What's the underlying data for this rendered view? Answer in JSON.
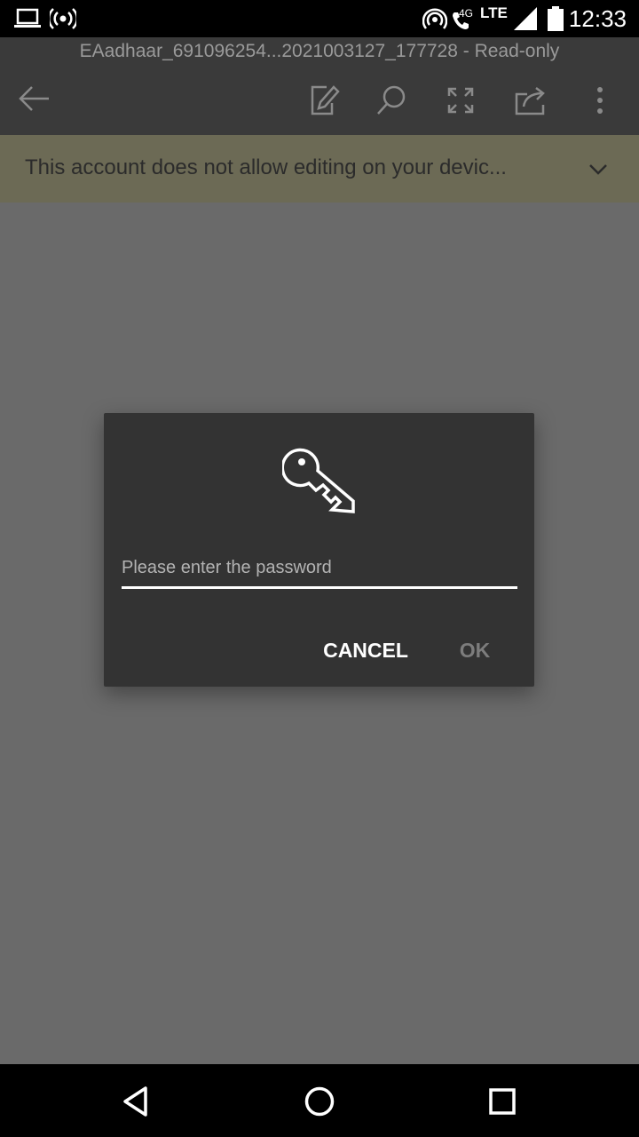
{
  "status_bar": {
    "time": "12:33",
    "network_4g": "4G",
    "network_lte": "LTE",
    "icons": [
      "laptop-icon",
      "hotspot-icon",
      "wifi-calling-icon",
      "signal-icon",
      "battery-icon"
    ]
  },
  "title_bar": {
    "document_title": "EAadhaar_691096254...2021003127_177728 - Read-only",
    "actions": [
      "back-arrow-icon",
      "edit-icon",
      "search-icon",
      "fullscreen-icon",
      "share-icon",
      "more-icon"
    ]
  },
  "banner": {
    "message": "This account does not allow editing on your devic..."
  },
  "password_dialog": {
    "icon": "key-icon",
    "input_placeholder": "Please enter the password",
    "input_value": "",
    "cancel_label": "CANCEL",
    "ok_label": "OK"
  },
  "nav_bar": {
    "buttons": [
      "back-icon",
      "home-icon",
      "recents-icon"
    ]
  },
  "colors": {
    "status_bar": "#000000",
    "title_bar": "#3a3a3a",
    "banner": "#6c6a55",
    "scrim": "#6a6a6a",
    "dialog": "#333333",
    "ok_disabled": "#7d7d7d"
  }
}
